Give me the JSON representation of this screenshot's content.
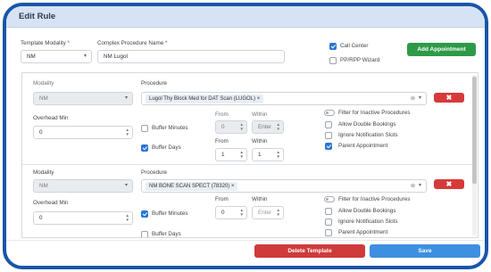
{
  "title": "Edit Rule",
  "header": {
    "template_modality_label": "Template Modality",
    "template_modality_value": "NM",
    "complex_procedure_label": "Complex Procedure Name",
    "complex_procedure_value": "NM Lugol",
    "required_mark": "*",
    "call_center_label": "Call Center",
    "call_center_checked": true,
    "pp_rpp_label": "PP/RPP Wizard",
    "pp_rpp_checked": false,
    "add_appointment_label": "Add Appointment"
  },
  "rows": [
    {
      "modality_label": "Modality",
      "modality_value": "NM",
      "procedure_label": "Procedure",
      "procedure_tag": "Lugol Thy Block Med for DAT Scan (LUGOL)",
      "remove_symbol": "✖",
      "overhead_label": "Overhead Min",
      "overhead_value": "0",
      "buffer_minutes_label": "Buffer Minutes",
      "buffer_minutes_checked": false,
      "from_label": "From",
      "within_label": "Within",
      "minutes_from": "0",
      "minutes_within": "Enter",
      "buffer_days_label": "Buffer Days",
      "buffer_days_checked": true,
      "days_from_label": "From",
      "days_within_label": "Within",
      "days_from": "1",
      "days_within": "1",
      "filter_inactive_label": "Filter for Inactive Procedures",
      "allow_double_label": "Allow Double Bookings",
      "allow_double_checked": false,
      "ignore_notification_label": "Ignore Notification Slots",
      "ignore_notification_checked": false,
      "parent_appointment_label": "Parent Appointment",
      "parent_appointment_checked": true
    },
    {
      "modality_label": "Modality",
      "modality_value": "NM",
      "procedure_label": "Procedure",
      "procedure_tag": "NM BONE SCAN SPECT (78320)",
      "remove_symbol": "✖",
      "overhead_label": "Overhead Min",
      "overhead_value": "0",
      "buffer_minutes_label": "Buffer Minutes",
      "buffer_minutes_checked": true,
      "from_label": "From",
      "within_label": "Within",
      "minutes_from": "0",
      "minutes_within": "Enter",
      "buffer_days_label": "Buffer Days",
      "buffer_days_checked": false,
      "filter_inactive_label": "Filter for Inactive Procedures",
      "allow_double_label": "Allow Double Bookings",
      "allow_double_checked": false,
      "ignore_notification_label": "Ignore Notification Slots",
      "ignore_notification_checked": false,
      "parent_appointment_label": "Parent Appointment",
      "parent_appointment_checked": false
    }
  ],
  "footer": {
    "delete_template_label": "Delete Template",
    "save_label": "Save"
  },
  "icons": {
    "tag_remove": "×",
    "clear": "⊗",
    "caret": "▾",
    "spin": "▲▼"
  },
  "colors": {
    "frame": "#1a55a8",
    "titlebar": "#d6e3f4",
    "add_button": "#2e9a48",
    "delete_button": "#cf3b3b",
    "save_button": "#3d8fe0",
    "checkbox_checked": "#2b75d6"
  }
}
